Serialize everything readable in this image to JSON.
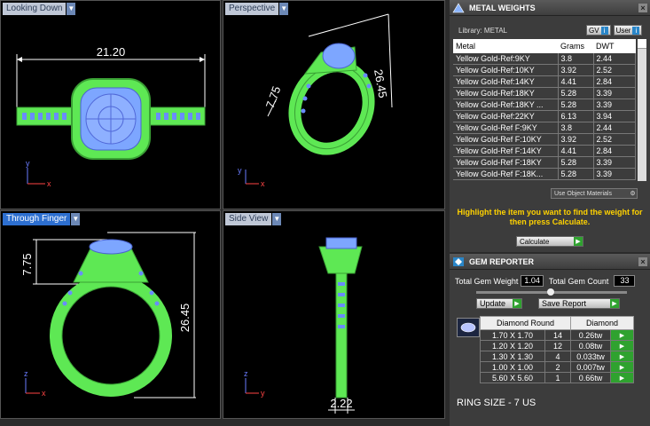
{
  "viewports": {
    "top_left": {
      "label": "Looking Down",
      "dim": "21.20"
    },
    "top_right": {
      "label": "Perspective",
      "dim1": "7.75",
      "dim2": "26.45"
    },
    "bottom_left": {
      "label": "Through Finger",
      "dim1": "7.75",
      "dim2": "26.45"
    },
    "bottom_right": {
      "label": "Side View",
      "dim": "2.22"
    }
  },
  "axes": {
    "x": "x",
    "y": "y",
    "z": "z"
  },
  "metal_weights": {
    "title": "METAL WEIGHTS",
    "library_label": "Library: METAL",
    "gv_label": "GV",
    "user_label": "User",
    "columns": [
      "Metal",
      "Grams",
      "DWT"
    ],
    "rows": [
      [
        "Yellow Gold-Ref:9KY",
        "3.8",
        "2.44"
      ],
      [
        "Yellow Gold-Ref:10KY",
        "3.92",
        "2.52"
      ],
      [
        "Yellow Gold-Ref:14KY",
        "4.41",
        "2.84"
      ],
      [
        "Yellow Gold-Ref:18KY",
        "5.28",
        "3.39"
      ],
      [
        "Yellow Gold-Ref:18KY ...",
        "5.28",
        "3.39"
      ],
      [
        "Yellow Gold-Ref:22KY",
        "6.13",
        "3.94"
      ],
      [
        "Yellow Gold-Ref F:9KY",
        "3.8",
        "2.44"
      ],
      [
        "Yellow Gold-Ref F:10KY",
        "3.92",
        "2.52"
      ],
      [
        "Yellow Gold-Ref F:14KY",
        "4.41",
        "2.84"
      ],
      [
        "Yellow Gold-Ref F:18KY",
        "5.28",
        "3.39"
      ],
      [
        "Yellow Gold-Ref F:18K...",
        "5.28",
        "3.39"
      ]
    ],
    "use_object_materials": "Use Object Materials",
    "instruction": "Highlight the item you want to find the weight for then press Calculate.",
    "calculate": "Calculate"
  },
  "gem_reporter": {
    "title": "GEM REPORTER",
    "total_weight_label": "Total Gem Weight",
    "total_weight": "1.04",
    "total_count_label": "Total Gem Count",
    "total_count": "33",
    "update": "Update",
    "save_report": "Save Report",
    "col_size": "Diamond Round",
    "col_type": "Diamond",
    "rows": [
      [
        "1.70 X 1.70",
        "14",
        "0.26tw"
      ],
      [
        "1.20 X 1.20",
        "12",
        "0.08tw"
      ],
      [
        "1.30 X 1.30",
        "4",
        "0.033tw"
      ],
      [
        "1.00 X 1.00",
        "2",
        "0.007tw"
      ],
      [
        "5.60 X 5.60",
        "1",
        "0.66tw"
      ]
    ],
    "ring_size": "RING SIZE - 7 US"
  },
  "colors": {
    "wire_green": "#66ff55",
    "gem_blue": "#8ea0ff",
    "accent_yellow": "#ffd200"
  }
}
